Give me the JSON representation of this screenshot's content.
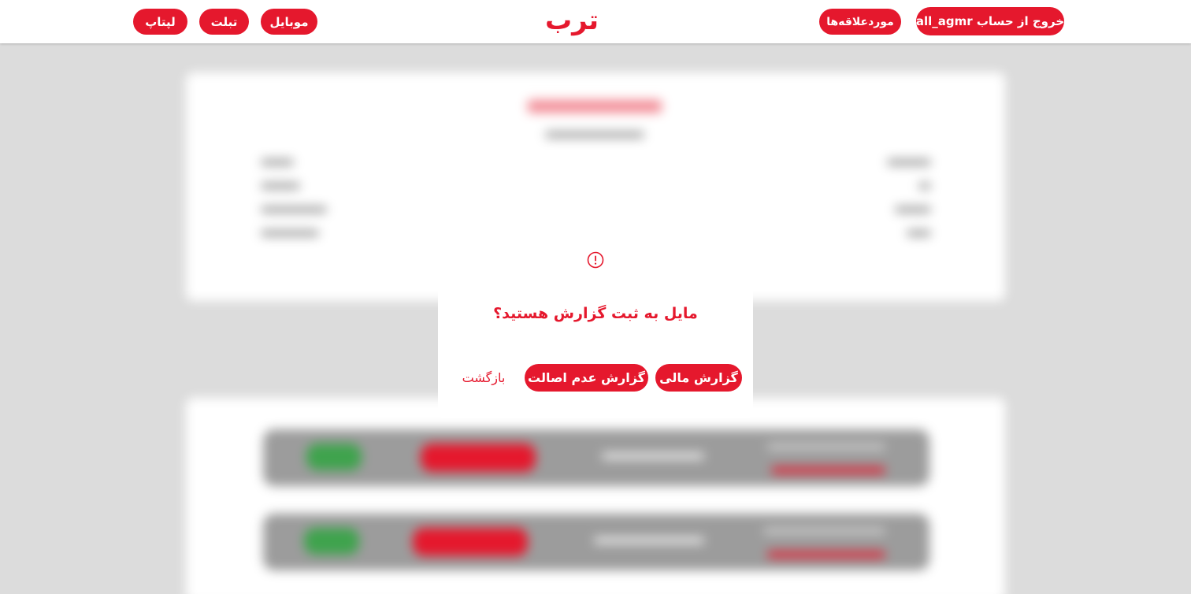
{
  "header": {
    "logo": "ترب",
    "categories": [
      "موبایل",
      "تبلت",
      "لپتاپ"
    ],
    "favorites_label": "موردعلاقه‌ها",
    "logout_label": "خروج از حساب all_agmr"
  },
  "dialog": {
    "question": "مایل به ثبت گزارش هستید؟",
    "financial_report_label": "گزارش مالی",
    "authenticity_report_label": "گزارش عدم اصالت",
    "back_label": "بازگشت",
    "icon": "alert-circle-icon"
  },
  "colors": {
    "brand": "#e5182d",
    "backdrop": "#dcdcdc",
    "green": "#3fa34d"
  }
}
